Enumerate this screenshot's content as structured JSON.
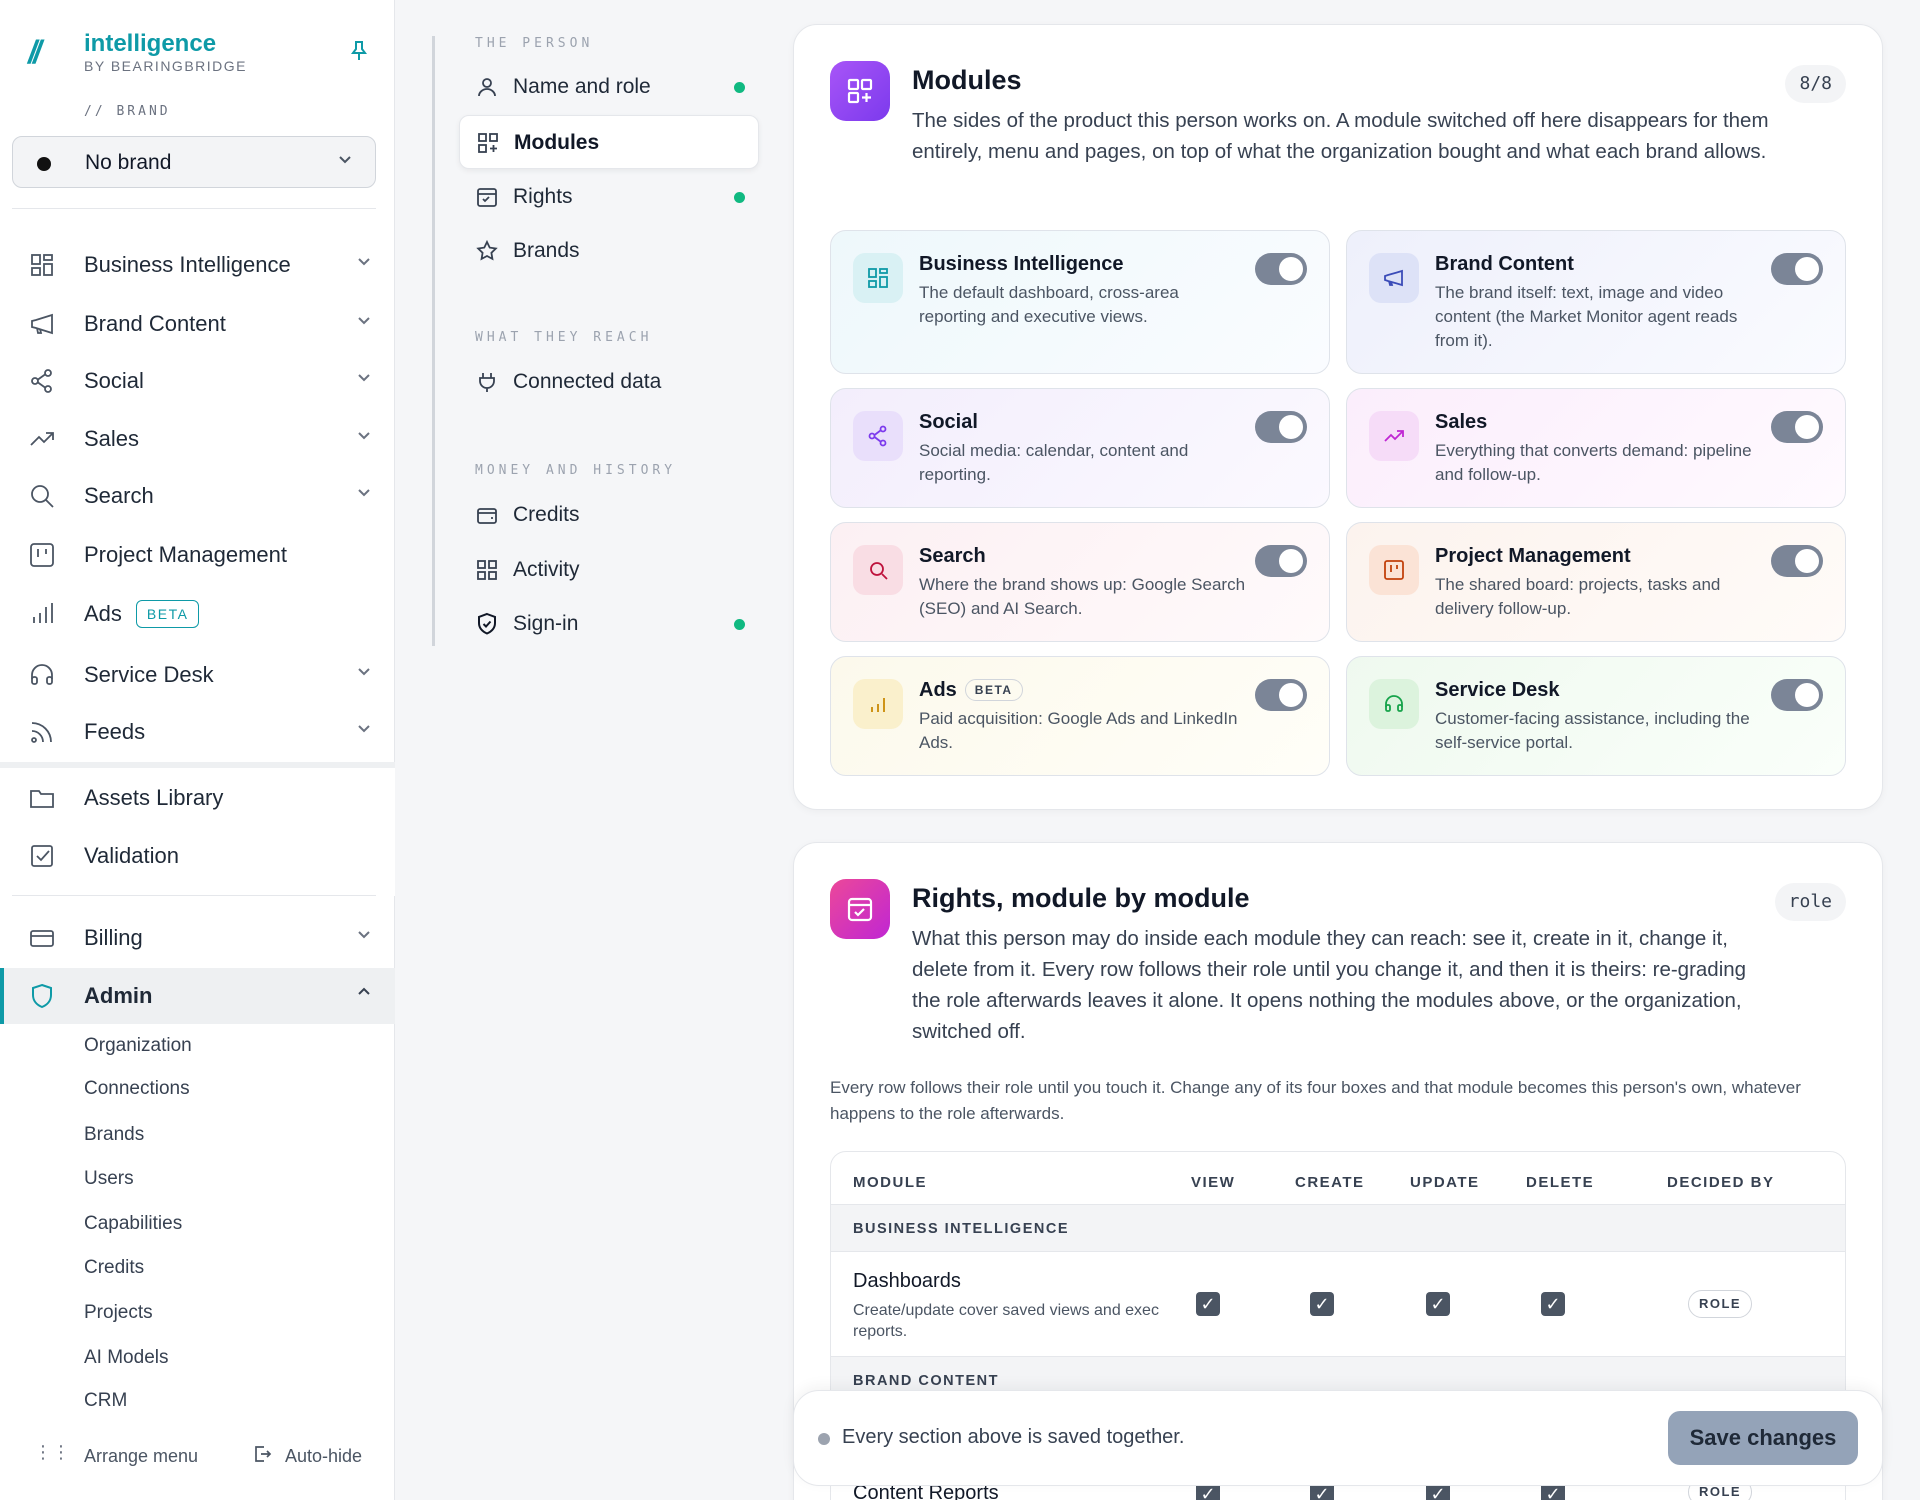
{
  "app": {
    "name": "intelligence",
    "byline": "BY BEARINGBRIDGE",
    "accent": "#0e9aa7"
  },
  "brand": {
    "label": "// BRAND",
    "selected": "No brand"
  },
  "nav": {
    "items": [
      {
        "label": "Business Intelligence",
        "icon": "dashboard-grid-icon"
      },
      {
        "label": "Brand Content",
        "icon": "megaphone-icon"
      },
      {
        "label": "Social",
        "icon": "share-icon"
      },
      {
        "label": "Sales",
        "icon": "trend-up-icon"
      },
      {
        "label": "Search",
        "icon": "search-icon"
      },
      {
        "label": "Project Management",
        "icon": "kanban-icon"
      },
      {
        "label": "Ads",
        "icon": "bar-chart-icon",
        "badge": "BETA"
      },
      {
        "label": "Service Desk",
        "icon": "headset-icon"
      },
      {
        "label": "Feeds",
        "icon": "rss-icon"
      },
      {
        "label": "Assets Library",
        "icon": "folder-icon"
      },
      {
        "label": "Validation",
        "icon": "checkbox-icon"
      },
      {
        "label": "Billing",
        "icon": "card-icon"
      },
      {
        "label": "Admin",
        "icon": "shield-icon"
      }
    ],
    "admin_sub": [
      "Organization",
      "Connections",
      "Brands",
      "Users",
      "Capabilities",
      "Credits",
      "Projects",
      "AI Models",
      "CRM"
    ],
    "footer": {
      "arrange": "Arrange menu",
      "autohide": "Auto-hide"
    }
  },
  "sections": {
    "person_head": "THE PERSON",
    "reach_head": "WHAT THEY REACH",
    "money_head": "MONEY AND HISTORY",
    "items": [
      {
        "label": "Name and role"
      },
      {
        "label": "Modules"
      },
      {
        "label": "Rights"
      },
      {
        "label": "Brands"
      },
      {
        "label": "Connected data"
      },
      {
        "label": "Credits"
      },
      {
        "label": "Activity"
      },
      {
        "label": "Sign-in"
      }
    ]
  },
  "modules_card": {
    "title": "Modules",
    "count": "8/8",
    "description": "The sides of the product this person works on. A module switched off here disappears for them entirely, menu and pages, on top of what the organization bought and what each brand allows.",
    "modules": [
      {
        "name": "Business Intelligence",
        "desc": "The default dashboard, cross-area reporting and executive views.",
        "color": "#0e9aa7"
      },
      {
        "name": "Brand Content",
        "desc": "The brand itself: text, image and video content (the Market Monitor agent reads from it).",
        "color": "#3b4cb8"
      },
      {
        "name": "Social",
        "desc": "Social media: calendar, content and reporting.",
        "color": "#7c3aed"
      },
      {
        "name": "Sales",
        "desc": "Everything that converts demand: pipeline and follow-up.",
        "color": "#c026d3"
      },
      {
        "name": "Search",
        "desc": "Where the brand shows up: Google Search (SEO) and AI Search.",
        "color": "#be123c"
      },
      {
        "name": "Project Management",
        "desc": "The shared board: projects, tasks and delivery follow-up.",
        "color": "#c2410c"
      },
      {
        "name": "Ads",
        "badge": "BETA",
        "desc": "Paid acquisition: Google Ads and LinkedIn Ads.",
        "color": "#ca8a04"
      },
      {
        "name": "Service Desk",
        "desc": "Customer-facing assistance, including the self-service portal.",
        "color": "#16a34a"
      }
    ]
  },
  "rights_card": {
    "title": "Rights, module by module",
    "tag": "role",
    "description": "What this person may do inside each module they can reach: see it, create in it, change it, delete from it. Every row follows their role until you change it, and then it is theirs: re-grading the role afterwards leaves it alone. It opens nothing the modules above, or the organization, switched off.",
    "note": "Every row follows their role until you touch it. Change any of its four boxes and that module becomes this person's own, whatever happens to the role afterwards.",
    "columns": [
      "MODULE",
      "VIEW",
      "CREATE",
      "UPDATE",
      "DELETE",
      "DECIDED BY"
    ],
    "group1": "BUSINESS INTELLIGENCE",
    "row1": {
      "name": "Dashboards",
      "desc": "Create/update cover saved views and exec reports.",
      "decided": "ROLE"
    },
    "group2": "BRAND CONTENT",
    "row2": {
      "name": "Content Reports",
      "decided": "ROLE"
    }
  },
  "savebar": {
    "status": "Every section above is saved together.",
    "button": "Save changes"
  }
}
